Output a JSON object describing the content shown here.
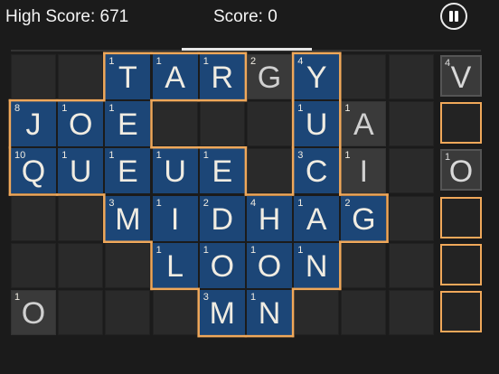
{
  "header": {
    "high_score": "High Score: 671",
    "score": "Score: 0"
  },
  "colors": {
    "word_tile": "#1c4677",
    "highlight": "#f0a85a",
    "empty": "#2a2a2a"
  },
  "board": [
    {
      "r": 0,
      "c": 2,
      "ch": "T",
      "sc": "1",
      "kind": "blue"
    },
    {
      "r": 0,
      "c": 3,
      "ch": "A",
      "sc": "1",
      "kind": "blue"
    },
    {
      "r": 0,
      "c": 4,
      "ch": "R",
      "sc": "1",
      "kind": "blue"
    },
    {
      "r": 0,
      "c": 5,
      "ch": "G",
      "sc": "2",
      "kind": "grey"
    },
    {
      "r": 0,
      "c": 6,
      "ch": "Y",
      "sc": "4",
      "kind": "blue"
    },
    {
      "r": 1,
      "c": 0,
      "ch": "J",
      "sc": "8",
      "kind": "blue"
    },
    {
      "r": 1,
      "c": 1,
      "ch": "O",
      "sc": "1",
      "kind": "blue"
    },
    {
      "r": 1,
      "c": 2,
      "ch": "E",
      "sc": "1",
      "kind": "blue"
    },
    {
      "r": 1,
      "c": 6,
      "ch": "U",
      "sc": "1",
      "kind": "blue"
    },
    {
      "r": 1,
      "c": 7,
      "ch": "A",
      "sc": "1",
      "kind": "grey"
    },
    {
      "r": 2,
      "c": 0,
      "ch": "Q",
      "sc": "10",
      "kind": "blue"
    },
    {
      "r": 2,
      "c": 1,
      "ch": "U",
      "sc": "1",
      "kind": "blue"
    },
    {
      "r": 2,
      "c": 2,
      "ch": "E",
      "sc": "1",
      "kind": "blue"
    },
    {
      "r": 2,
      "c": 3,
      "ch": "U",
      "sc": "1",
      "kind": "blue"
    },
    {
      "r": 2,
      "c": 4,
      "ch": "E",
      "sc": "1",
      "kind": "blue"
    },
    {
      "r": 2,
      "c": 6,
      "ch": "C",
      "sc": "3",
      "kind": "blue"
    },
    {
      "r": 2,
      "c": 7,
      "ch": "I",
      "sc": "1",
      "kind": "grey"
    },
    {
      "r": 3,
      "c": 2,
      "ch": "M",
      "sc": "3",
      "kind": "blue"
    },
    {
      "r": 3,
      "c": 3,
      "ch": "I",
      "sc": "1",
      "kind": "blue"
    },
    {
      "r": 3,
      "c": 4,
      "ch": "D",
      "sc": "2",
      "kind": "blue"
    },
    {
      "r": 3,
      "c": 5,
      "ch": "H",
      "sc": "4",
      "kind": "blue"
    },
    {
      "r": 3,
      "c": 6,
      "ch": "A",
      "sc": "1",
      "kind": "blue"
    },
    {
      "r": 3,
      "c": 7,
      "ch": "G",
      "sc": "2",
      "kind": "blue"
    },
    {
      "r": 4,
      "c": 3,
      "ch": "L",
      "sc": "1",
      "kind": "blue"
    },
    {
      "r": 4,
      "c": 4,
      "ch": "O",
      "sc": "1",
      "kind": "blue"
    },
    {
      "r": 4,
      "c": 5,
      "ch": "O",
      "sc": "1",
      "kind": "blue"
    },
    {
      "r": 4,
      "c": 6,
      "ch": "N",
      "sc": "1",
      "kind": "blue"
    },
    {
      "r": 5,
      "c": 0,
      "ch": "O",
      "sc": "1",
      "kind": "grey"
    },
    {
      "r": 5,
      "c": 4,
      "ch": "M",
      "sc": "3",
      "kind": "blue"
    },
    {
      "r": 5,
      "c": 5,
      "ch": "N",
      "sc": "1",
      "kind": "blue"
    }
  ],
  "rack": [
    {
      "ch": "V",
      "sc": "4"
    },
    {
      "ch": "",
      "sc": ""
    },
    {
      "ch": "O",
      "sc": "1"
    },
    {
      "ch": "",
      "sc": ""
    },
    {
      "ch": "",
      "sc": ""
    },
    {
      "ch": "",
      "sc": ""
    }
  ]
}
